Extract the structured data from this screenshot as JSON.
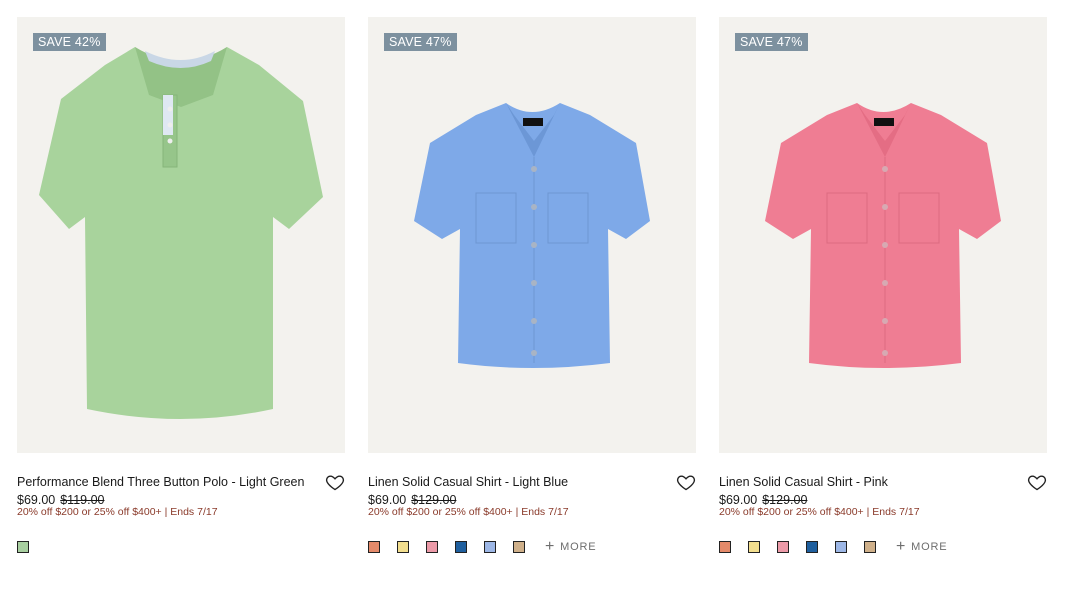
{
  "products": [
    {
      "badge": "SAVE 42%",
      "title": "Performance Blend Three Button Polo - Light Green",
      "price_now": "$69.00",
      "price_was": "$119.00",
      "promo": "20% off $200 or 25% off $400+ | Ends 7/17",
      "shirt_color": "#a8d39c",
      "swatches": [
        "#a8cfa0"
      ],
      "more_label": ""
    },
    {
      "badge": "SAVE 47%",
      "title": "Linen Solid Casual Shirt - Light Blue",
      "price_now": "$69.00",
      "price_was": "$129.00",
      "promo": "20% off $200 or 25% off $400+ | Ends 7/17",
      "shirt_color": "#7ea9e8",
      "swatches": [
        "#e48a6a",
        "#f3df8f",
        "#ec9aa8",
        "#1f5f9e",
        "#9db7e6",
        "#cfb08a"
      ],
      "more_label": "MORE"
    },
    {
      "badge": "SAVE 47%",
      "title": "Linen Solid Casual Shirt - Pink",
      "price_now": "$69.00",
      "price_was": "$129.00",
      "promo": "20% off $200 or 25% off $400+ | Ends 7/17",
      "shirt_color": "#ef7d93",
      "swatches": [
        "#e48a6a",
        "#f3df8f",
        "#ec9aa8",
        "#1f5f9e",
        "#9db7e6",
        "#cfb08a"
      ],
      "more_label": "MORE"
    }
  ],
  "colors": {
    "card_background": "#f3f2ee",
    "badge_background": "#7d919f",
    "promo_text": "#8a3a2a"
  },
  "icons": {
    "favorite": "heart-outline-icon",
    "more": "plus-icon"
  }
}
